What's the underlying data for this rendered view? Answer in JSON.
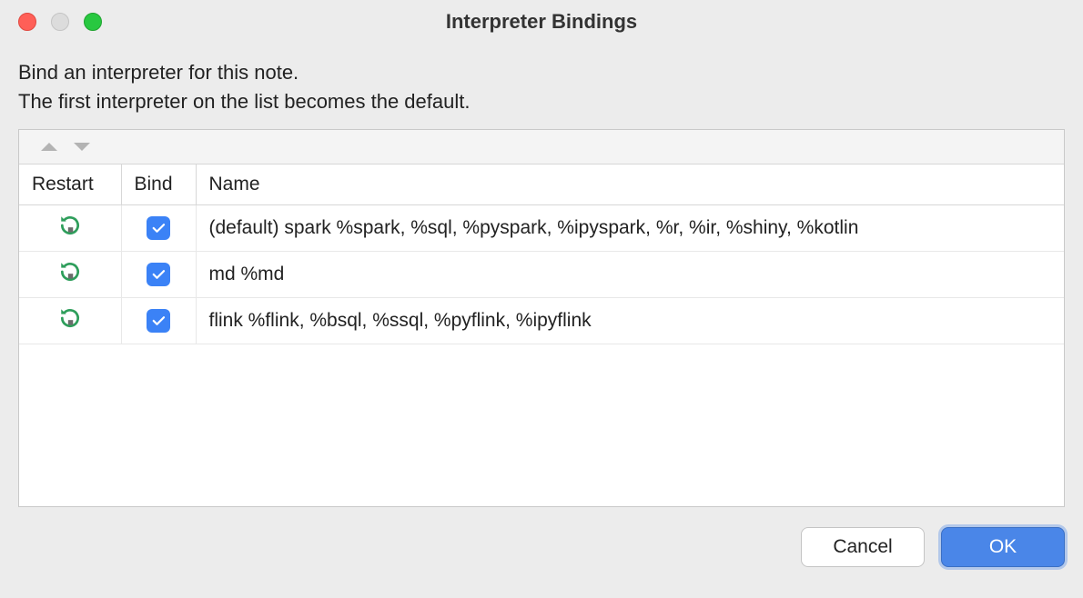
{
  "window": {
    "title": "Interpreter Bindings"
  },
  "instructions": {
    "line1": "Bind an interpreter for this note.",
    "line2": "The first interpreter on the list becomes the default."
  },
  "table": {
    "headers": {
      "restart": "Restart",
      "bind": "Bind",
      "name": "Name"
    },
    "rows": [
      {
        "bound": true,
        "name": "(default) spark %spark, %sql, %pyspark, %ipyspark, %r, %ir, %shiny, %kotlin"
      },
      {
        "bound": true,
        "name": "md %md"
      },
      {
        "bound": true,
        "name": "flink %flink, %bsql, %ssql, %pyflink, %ipyflink"
      }
    ]
  },
  "buttons": {
    "cancel": "Cancel",
    "ok": "OK"
  }
}
